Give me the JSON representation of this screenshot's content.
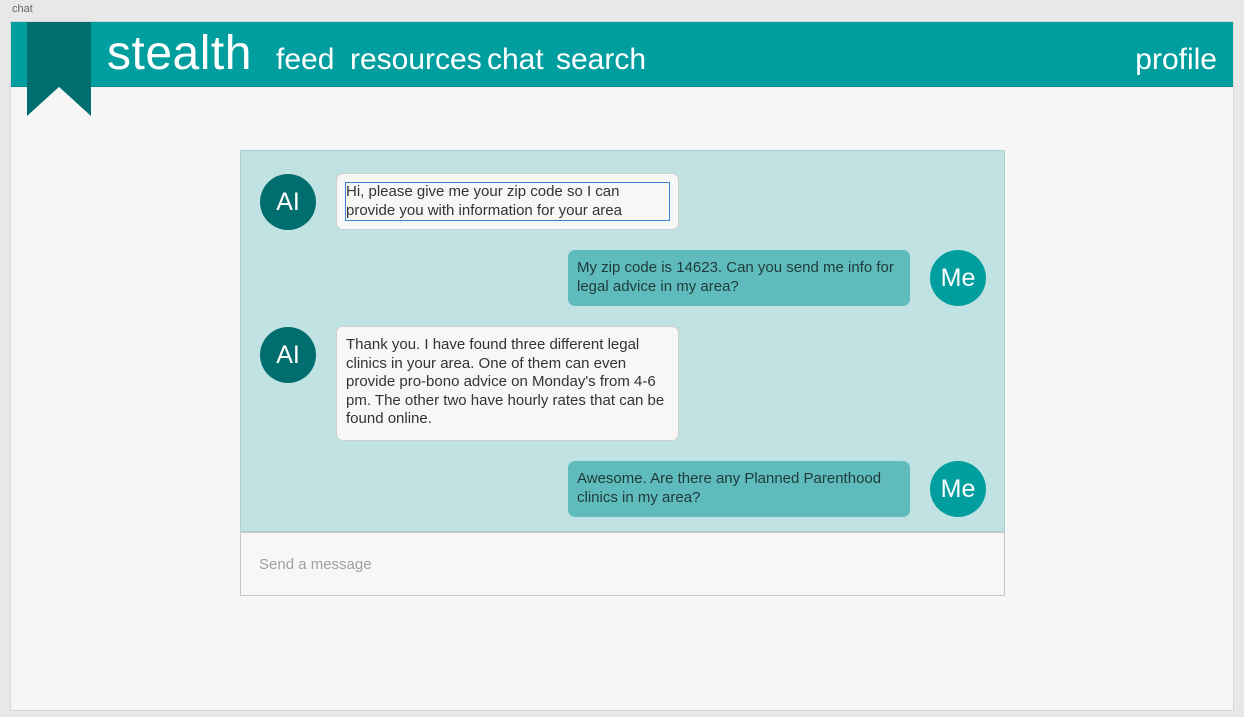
{
  "frame_label": "chat",
  "header": {
    "brand": "stealth",
    "nav": {
      "feed": "feed",
      "resources": "resources",
      "chat": "chat",
      "search": "search",
      "profile": "profile"
    }
  },
  "colors": {
    "header": "#009e9e",
    "bookmark": "#006e6e",
    "chat_panel": "#c0e2e2",
    "ai_avatar": "#006e6e",
    "me_avatar": "#009e9e",
    "me_bubble": "#60bcbc"
  },
  "messages": [
    {
      "sender": "AI",
      "text": "Hi, please give me your zip code so I can provide you with information for your area"
    },
    {
      "sender": "Me",
      "text": "My zip code is 14623. Can you send me info for legal advice in my area?"
    },
    {
      "sender": "AI",
      "text": "Thank you. I have found three different legal clinics in your area. One of them can even provide pro-bono advice on Monday's from 4-6 pm. The other two have hourly rates that can be found online."
    },
    {
      "sender": "Me",
      "text": "Awesome. Are there any Planned Parenthood clinics in my area?"
    }
  ],
  "composer": {
    "placeholder": "Send a message",
    "value": ""
  }
}
